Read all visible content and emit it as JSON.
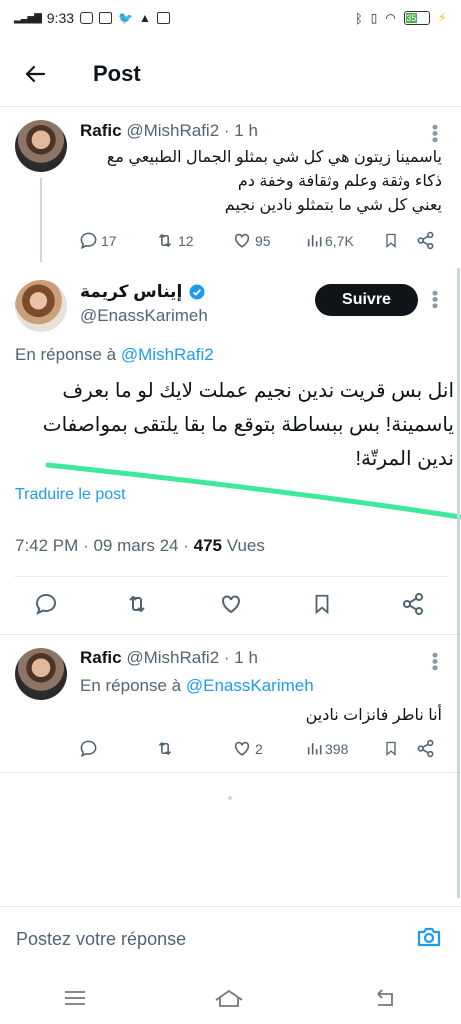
{
  "status": {
    "time": "9:33",
    "battery": "35"
  },
  "header": {
    "title": "Post"
  },
  "tweets": [
    {
      "name": "Rafic",
      "handle": "@MishRafi2",
      "age": "· 1 h",
      "text_lines": [
        "ياسمينا زيتون هي كل شي بمثلو الجمال الطبيعي مع",
        "ذكاء وثقة وعلم وثقافة وخفة دم",
        "يعني كل شي ما بتمثلو  نادين نجيم"
      ],
      "stats": {
        "replies": "17",
        "reposts": "12",
        "likes": "95",
        "views": "6,7K"
      }
    },
    {
      "name": "Rafic",
      "handle": "@MishRafi2",
      "age": "· 1 h",
      "reply_prefix": "En réponse à",
      "reply_to": "@EnassKarimeh",
      "text": "أنا ناطر فانزات نادين",
      "stats": {
        "replies": "",
        "reposts": "",
        "likes": "2",
        "views": "398"
      }
    }
  ],
  "main": {
    "name": "إيناس كريمة",
    "handle": "@EnassKarimeh",
    "follow_label": "Suivre",
    "reply_prefix": "En réponse à",
    "reply_to": "@MishRafi2",
    "text_lines": [
      "انل بس قريت ندين نجيم عملت لايك لو ما بعرف",
      "ياسمينة! بس ببساطة بتوقع ما بقا يلتقى بمواصفات",
      "ندين المرتّة!"
    ],
    "translate": "Traduire le post",
    "time": "7:42 PM",
    "date": "09 mars 24",
    "views_count": "475",
    "views_label": "Vues",
    "sep": "·"
  },
  "reply_box": {
    "placeholder": "Postez votre réponse"
  },
  "colors": {
    "accent": "#1d9bf0",
    "marker": "#3ee89c"
  }
}
